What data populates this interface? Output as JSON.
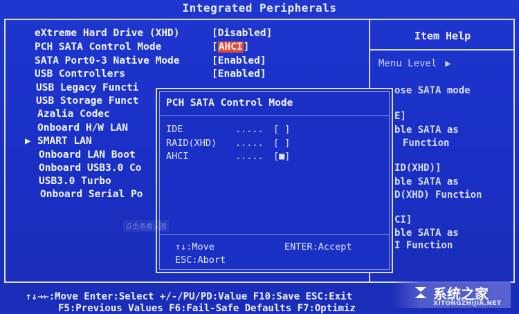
{
  "title": "Integrated Peripherals",
  "help": {
    "title": "Item Help",
    "menu_level": "Menu Level",
    "menu_level_arrow": "▶"
  },
  "settings": [
    {
      "label": "eXtreme Hard Drive (XHD)",
      "value": "[Disabled]"
    },
    {
      "label": "PCH SATA Control Mode",
      "value_open": "[",
      "value_selected": "AHCI",
      "value_close": "]"
    },
    {
      "label": "SATA Port0-3 Native Mode",
      "value": "[Enabled]"
    },
    {
      "label": "USB Controllers",
      "value": "[Enabled]"
    },
    {
      "label": "USB Legacy Functi"
    },
    {
      "label": "USB Storage Funct"
    },
    {
      "label": "Azalia Codec"
    },
    {
      "label": "Onboard H/W LAN"
    },
    {
      "label": "SMART LAN"
    },
    {
      "label": "Onboard LAN Boot"
    },
    {
      "label": "Onboard USB3.0 Co"
    },
    {
      "label": "USB3.0 Turbo"
    },
    {
      "label": "Onboard Serial Po"
    }
  ],
  "pointer": "▶",
  "help_lines": [
    "ose SATA mode",
    "E]",
    "ble SATA as",
    "Function",
    "ID(XHD)]",
    "ble SATA as",
    "D(XHD) Function",
    "CI]",
    "ble SATA as",
    "I Function"
  ],
  "popup": {
    "title": "PCH SATA Control Mode",
    "options": [
      {
        "name": "IDE",
        "dots": ".....",
        "box": "[ ]"
      },
      {
        "name": "RAID(XHD)",
        "dots": ".....",
        "box": "[ ]"
      },
      {
        "name": "AHCI",
        "dots": ".....",
        "box": "[■]"
      }
    ],
    "keys": {
      "move": "↑↓:Move",
      "accept": "ENTER:Accept",
      "abort": "ESC:Abort"
    }
  },
  "watermark": "点击查看大图",
  "footer": {
    "line1": "↑↓→←:Move   Enter:Select   +/-/PU/PD:Value   F10:Save   ESC:Exit",
    "line2": "F5:Previous Values   F6:Fail-Safe Defaults   F7:Optimiz"
  },
  "logo": {
    "name": "系统之家",
    "url": "XITONGZHIJIA.NET"
  }
}
